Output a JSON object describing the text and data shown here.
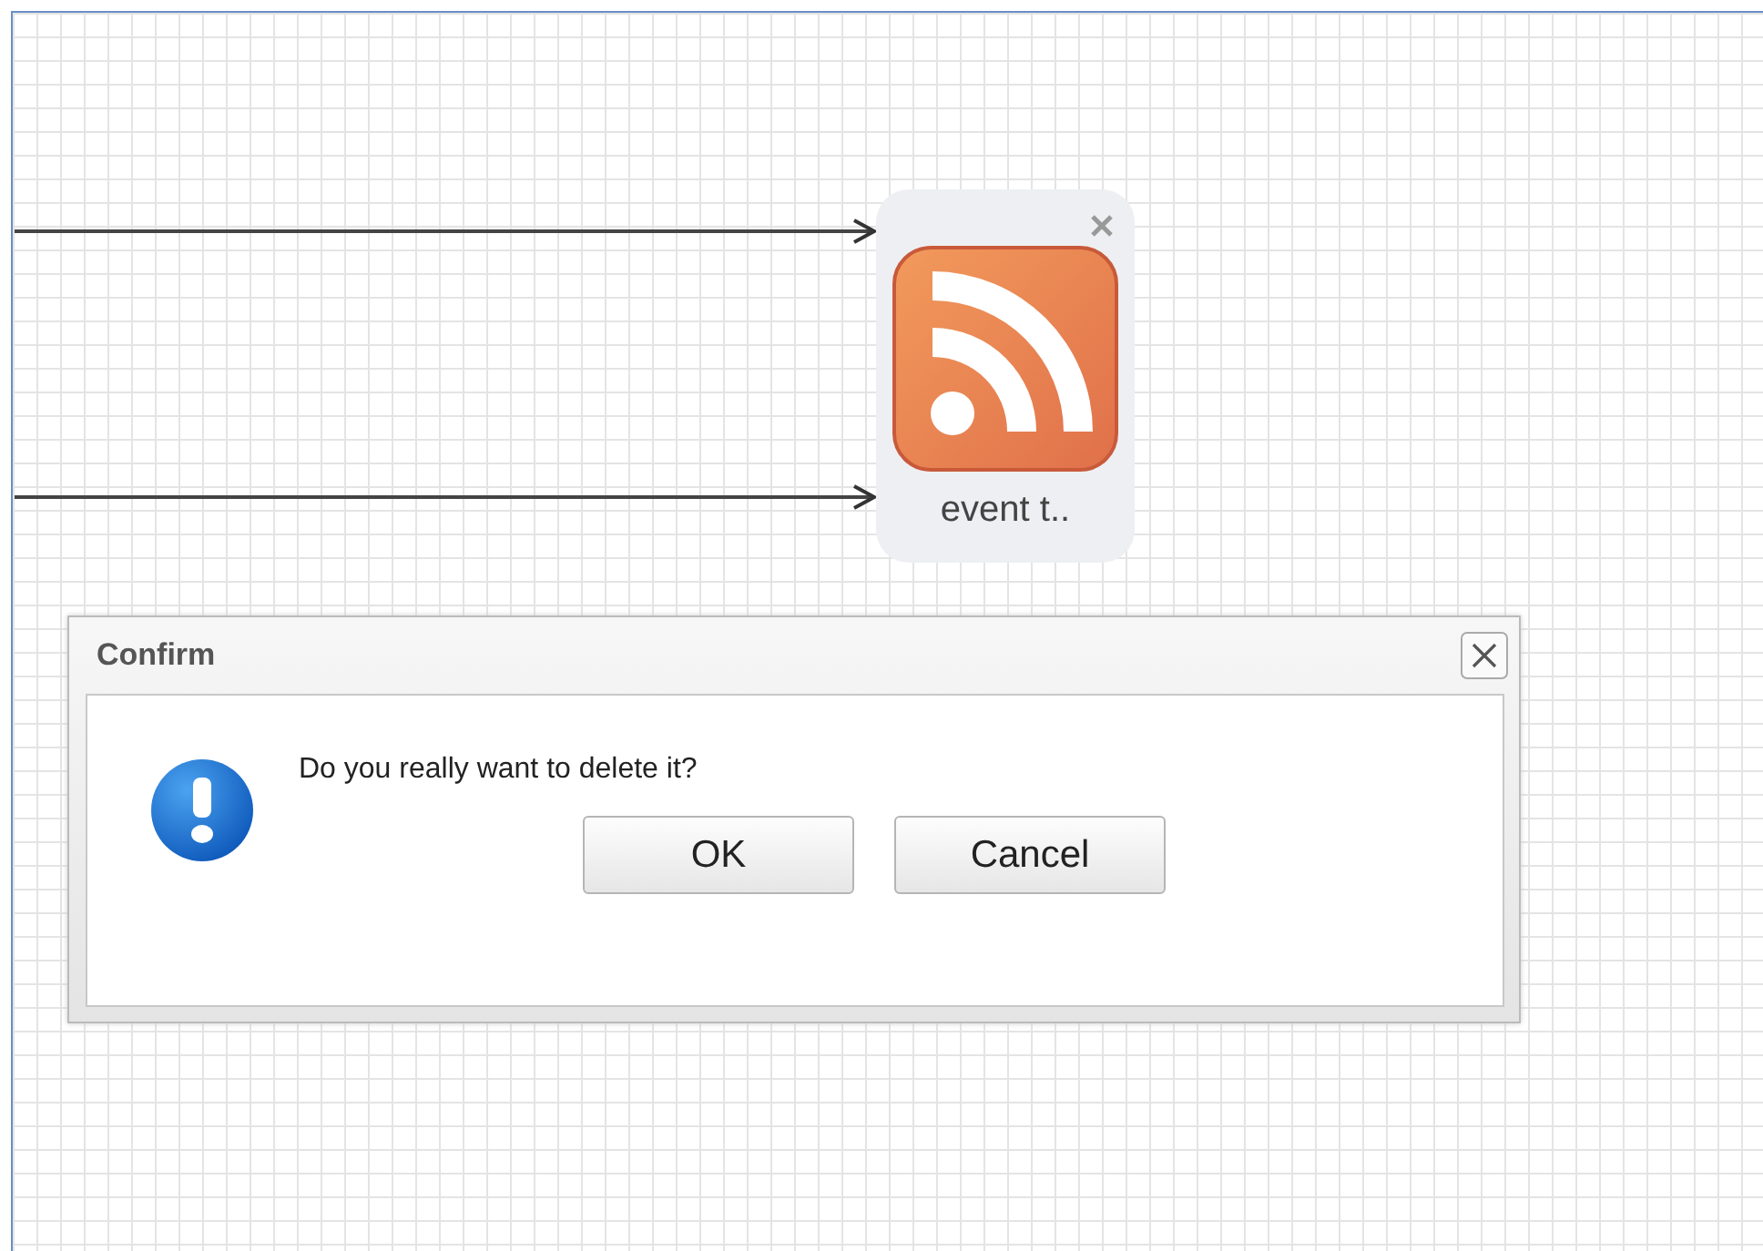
{
  "node": {
    "label": "event t.."
  },
  "dialog": {
    "title": "Confirm",
    "message": "Do you really want to delete it?",
    "buttons": [
      {
        "label": "OK"
      },
      {
        "label": "Cancel"
      }
    ]
  }
}
